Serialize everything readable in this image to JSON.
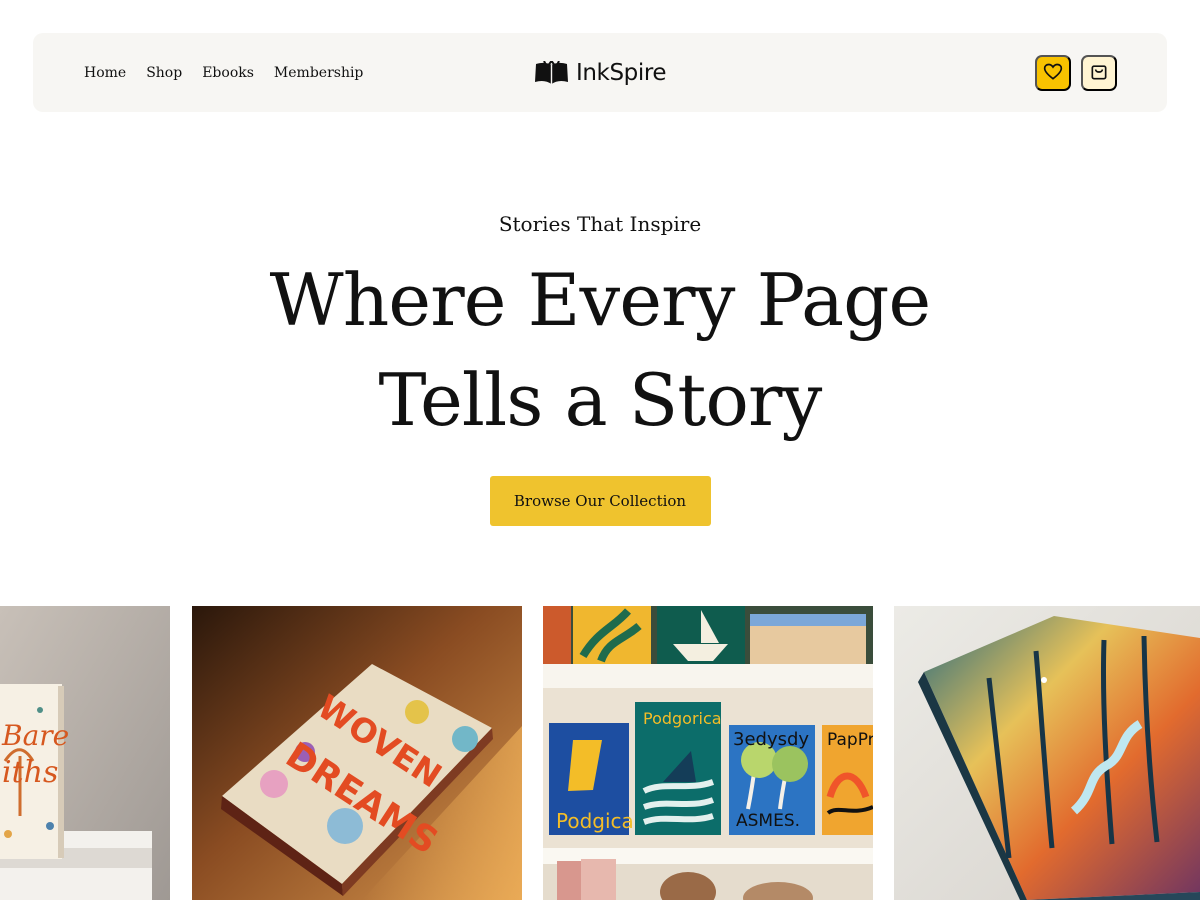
{
  "header": {
    "nav": [
      "Home",
      "Shop",
      "Ebooks",
      "Membership"
    ],
    "logo_text": "InkSpire",
    "actions": [
      "heart-icon",
      "shopping-bag-icon"
    ]
  },
  "hero": {
    "eyebrow": "Stories That Inspire",
    "title": "Where Every Page Tells a Story",
    "cta": "Browse Our Collection"
  },
  "gallery": {
    "tiles": [
      {
        "name": "book-photo-bare-myths",
        "cover_lines": [
          "Bare",
          "iths"
        ]
      },
      {
        "name": "book-photo-woven-dreams",
        "cover_lines": [
          "WOVEN",
          "DREAMS"
        ]
      },
      {
        "name": "bookshelf-photo",
        "book_titles": [
          "Podgica",
          "Podgorica",
          "3edysdy",
          "ASMES.",
          "PapPr"
        ]
      },
      {
        "name": "book-photo-forest-path",
        "cover_lines": []
      }
    ]
  },
  "colors": {
    "accent": "#f2c21d",
    "header_bg": "#f7f6f3",
    "text": "#111111"
  }
}
